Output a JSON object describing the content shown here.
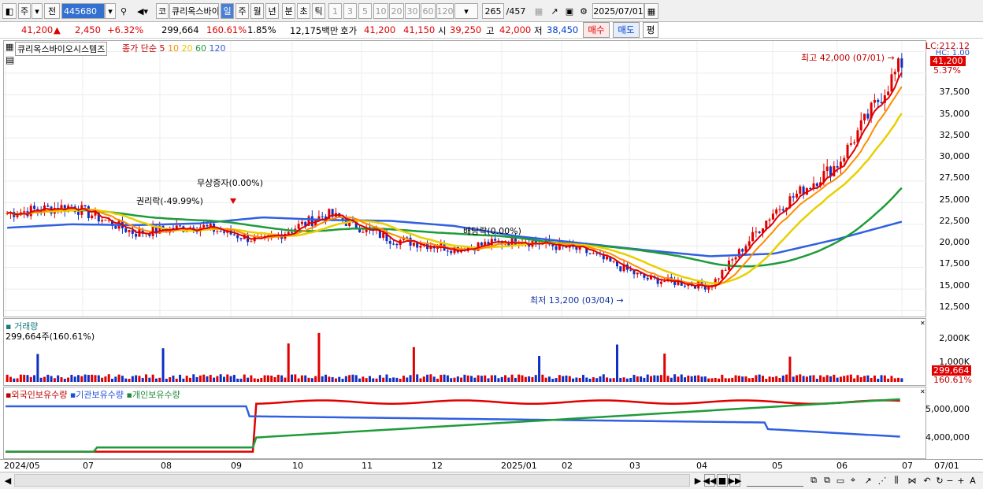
{
  "toolbar": {
    "market": "주",
    "prev": "전",
    "code": "445680",
    "kospi": "코",
    "name": "큐리옥스바이",
    "period_tabs": [
      "일",
      "주",
      "월",
      "년",
      "분",
      "초",
      "틱"
    ],
    "active_period": "일",
    "intervals": [
      "1",
      "3",
      "5",
      "10",
      "20",
      "30",
      "60",
      "120"
    ],
    "count": "265",
    "total": "/457",
    "date": "2025/07/01"
  },
  "quote": {
    "price": "41,200",
    "arrow": "▲",
    "change": "2,450",
    "change_pct": "+6.32%",
    "volume": "299,664",
    "volume_ratio": "160.61%",
    "turnover": "1.85%",
    "amount": "12,175백만",
    "hoga_label": "호가",
    "ask": "41,200",
    "bid": "41,150",
    "open_label": "시",
    "open": "39,250",
    "high_label": "고",
    "high": "42,000",
    "low_label": "저",
    "low": "38,450",
    "buy": "매수",
    "sell": "매도",
    "eval": "평"
  },
  "price_panel": {
    "title": "큐리옥스바이오시스템즈",
    "ma_label": "종가 단순",
    "ma_periods": [
      "5",
      "10",
      "20",
      "60",
      "120"
    ],
    "ma_colors": [
      "#e00000",
      "#ff8c00",
      "#e8d000",
      "#1e9b3a",
      "#3060e0"
    ],
    "lc": "LC:212.12",
    "hc": "HC: 1.00",
    "cur_price": "41,200",
    "cur_pct": "5.37%",
    "high_note": "최고 42,000 (07/01)",
    "low_note": "최저 13,200 (03/04)",
    "ev1": "무상증자(0.00%)",
    "ev2": "권리락(-49.99%)",
    "ev3": "배당락(0.00%)",
    "ticks": [
      "37,500",
      "35,000",
      "32,500",
      "30,000",
      "27,500",
      "25,000",
      "22,500",
      "20,000",
      "17,500",
      "15,000",
      "12,500"
    ]
  },
  "volume_panel": {
    "title": "거래량",
    "sub": "299,664주(160.61%)",
    "ticks": [
      "2,000K",
      "1,000K"
    ],
    "cur": "299,664",
    "pct": "160.61%"
  },
  "holding_panel": {
    "l1": "외국인보유수량",
    "l2": "기관보유수량",
    "l3": "개인보유수량",
    "ticks": [
      "5,000,000",
      "4,000,000"
    ]
  },
  "x_axis": [
    "2024/05",
    "07",
    "08",
    "09",
    "10",
    "11",
    "12",
    "2025/01",
    "02",
    "03",
    "04",
    "05",
    "06",
    "07"
  ],
  "x_right": "07/01",
  "chart_data": {
    "type": "line",
    "title": "큐리옥스바이오시스템즈",
    "x": [
      "2024/05",
      "07",
      "08",
      "09",
      "10",
      "11",
      "12",
      "2025/01",
      "02",
      "03",
      "04",
      "05",
      "06",
      "07"
    ],
    "series": [
      {
        "name": "5",
        "values": [
          23800,
          24600,
          21500,
          22300,
          20500,
          23700,
          20800,
          19700,
          20700,
          19500,
          16200,
          15300,
          24000,
          29500,
          41200
        ]
      },
      {
        "name": "120",
        "values": [
          22100,
          22500,
          22400,
          22600,
          23300,
          23000,
          22900,
          22300,
          21100,
          20300,
          19500,
          18800,
          19100,
          20800,
          22800
        ]
      }
    ],
    "ylim": [
      12000,
      43000
    ]
  }
}
